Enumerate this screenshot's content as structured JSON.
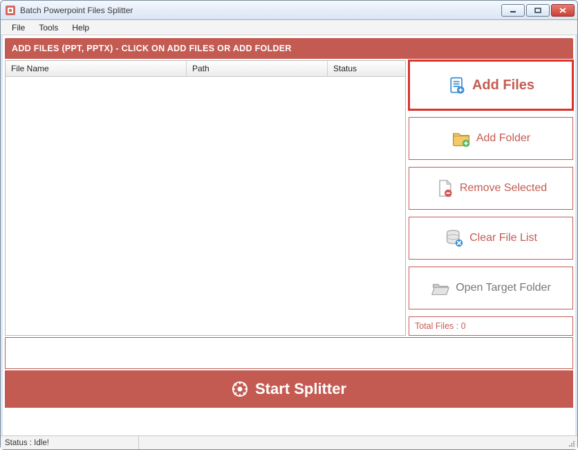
{
  "window": {
    "title": "Batch Powerpoint Files Splitter"
  },
  "menu": {
    "file": "File",
    "tools": "Tools",
    "help": "Help"
  },
  "section_header": "ADD FILES (PPT, PPTX) - CLICK ON ADD FILES OR ADD FOLDER",
  "columns": {
    "file": "File Name",
    "path": "Path",
    "status": "Status"
  },
  "buttons": {
    "add_files": "Add Files",
    "add_folder": "Add Folder",
    "remove_selected": "Remove Selected",
    "clear_list": "Clear File List",
    "open_target": "Open Target Folder"
  },
  "total_files_label": "Total Files : 0",
  "start_label": "Start Splitter",
  "status": {
    "text": "Status  :  Idle!"
  }
}
